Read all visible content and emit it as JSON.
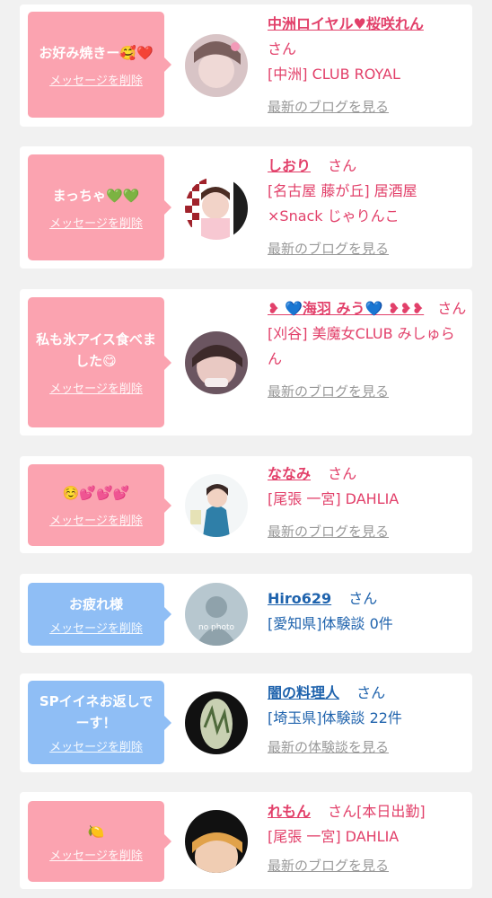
{
  "common": {
    "delete_label": "メッセージを削除",
    "san": "さん",
    "blog_link": "最新のブログを見る",
    "review_link": "最新の体験談を見る"
  },
  "items": [
    {
      "message": "お好み焼きー🥰❤️",
      "name": "中洲ロイヤル♥桜咲れん",
      "shop": "[中洲] CLUB ROYAL",
      "link": "最新のブログを見る",
      "status": ""
    },
    {
      "message": "まっちゃ💚💚",
      "name": "しおり",
      "shop": "[名古屋 藤が丘] 居酒屋×Snack じゃりんこ",
      "link": "最新のブログを見る",
      "status": ""
    },
    {
      "message": "私も氷アイス食べました😋",
      "name": "❥ 💙海羽 みう💙 ❥❥❥",
      "shop": "[刈谷] 美魔女CLUB みしゅらん",
      "link": "最新のブログを見る",
      "status": ""
    },
    {
      "message": "☺️💕💕💕",
      "name": "ななみ",
      "shop": "[尾張 一宮] DAHLIA",
      "link": "最新のブログを見る",
      "status": ""
    },
    {
      "message": "お疲れ様",
      "name": "Hiro629",
      "shop": "[愛知県]体験談 0件",
      "link": "",
      "status": "",
      "avatar_text": "no photo"
    },
    {
      "message": "SPイイネお返しでーす！",
      "name": "闇の料理人",
      "shop": "[埼玉県]体験談 22件",
      "link": "最新の体験談を見る",
      "status": ""
    },
    {
      "message": "🍋",
      "name": "れもん",
      "shop": "[尾張 一宮] DAHLIA",
      "link": "最新のブログを見る",
      "status": "[本日出勤]"
    }
  ],
  "colors": {
    "pink_bubble": "#fba3b0",
    "blue_bubble": "#8fbef5",
    "pink_text": "#e2406a",
    "blue_text": "#1f63ad"
  }
}
